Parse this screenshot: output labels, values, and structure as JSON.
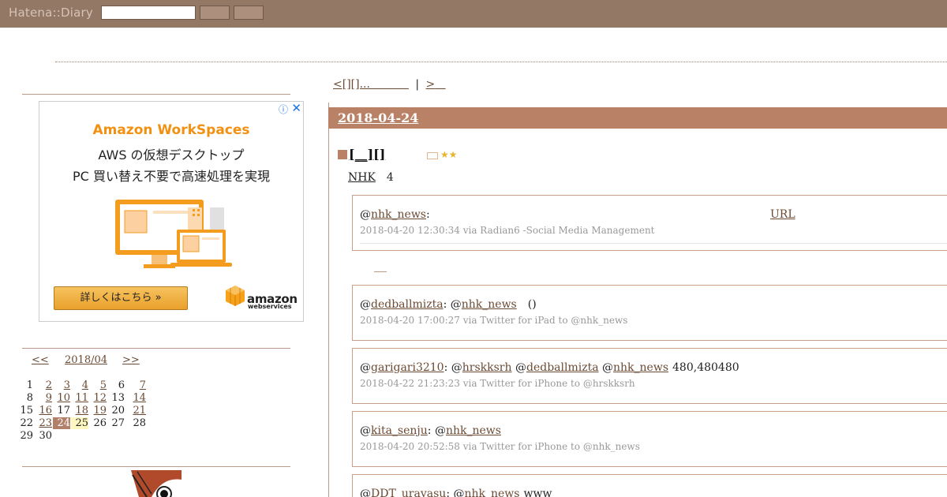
{
  "header": {
    "logo": "Hatena::Diary",
    "search": {
      "value": "",
      "placeholder": ""
    },
    "buttons": [
      "",
      ""
    ]
  },
  "ad": {
    "title": "Amazon WorkSpaces",
    "line1": "AWS の仮想デスクトップ",
    "line2": "PC 買い替え不要で高速処理を実現",
    "cta": "詳しくはこちら »",
    "brand": "amazon",
    "brand_sub": "webservices",
    "info_icon": "info-icon",
    "close_icon": "close-icon"
  },
  "calendar": {
    "prev": "<<",
    "month": "2018/04",
    "next": ">>",
    "weeks": [
      [
        {
          "d": "1",
          "link": false
        },
        {
          "d": "2",
          "link": true
        },
        {
          "d": "3",
          "link": true
        },
        {
          "d": "4",
          "link": true
        },
        {
          "d": "5",
          "link": true
        },
        {
          "d": "6",
          "link": false
        },
        {
          "d": "7",
          "link": true
        }
      ],
      [
        {
          "d": "8",
          "link": false
        },
        {
          "d": "9",
          "link": true
        },
        {
          "d": "10",
          "link": true
        },
        {
          "d": "11",
          "link": true
        },
        {
          "d": "12",
          "link": true
        },
        {
          "d": "13",
          "link": false
        },
        {
          "d": "14",
          "link": true
        }
      ],
      [
        {
          "d": "15",
          "link": false
        },
        {
          "d": "16",
          "link": true
        },
        {
          "d": "17",
          "link": false
        },
        {
          "d": "18",
          "link": true
        },
        {
          "d": "19",
          "link": true
        },
        {
          "d": "20",
          "link": false
        },
        {
          "d": "21",
          "link": true
        }
      ],
      [
        {
          "d": "22",
          "link": false
        },
        {
          "d": "23",
          "link": true
        },
        {
          "d": "24",
          "link": false,
          "today": true
        },
        {
          "d": "25",
          "link": false,
          "hl": true
        },
        {
          "d": "26",
          "link": false
        },
        {
          "d": "27",
          "link": false
        },
        {
          "d": "28",
          "link": false
        }
      ],
      [
        {
          "d": "29",
          "link": false
        },
        {
          "d": "30",
          "link": false
        }
      ]
    ]
  },
  "pager": {
    "prev": "<[][]...",
    "sep": "|",
    "next": ">"
  },
  "entry": {
    "date": "2018-04-24",
    "section_title": "[__][]",
    "stars": "★★",
    "intro_nhk": "NHK",
    "intro_count": "4"
  },
  "tweets": [
    {
      "prefix": "@",
      "user": "nhk_news",
      "after": ":",
      "extra_link": "URL",
      "meta": "2018-04-20 12:30:34 via Radian6 -Social Media Management"
    },
    {
      "prefix": "@",
      "user": "dedballmizta",
      "mid": ": @",
      "mention": "nhk_news",
      "tail": "()",
      "meta": "2018-04-20 17:00:27 via Twitter for iPad to @nhk_news"
    },
    {
      "prefix": "@",
      "user": "garigari3210",
      "mid": ": @",
      "mention": "hrskksrh",
      "mid2": " @",
      "mention2": "dedballmizta",
      "mid3": " @",
      "mention3": "nhk_news",
      "tail": "480,480480",
      "meta": "2018-04-22 21:23:23 via Twitter for iPhone to @hrskksrh"
    },
    {
      "prefix": "@",
      "user": "kita_senju",
      "mid": ": @",
      "mention": "nhk_news",
      "meta": "2018-04-20 20:52:58 via Twitter for iPhone to @nhk_news"
    },
    {
      "prefix": "@",
      "user": "DDT_urayasu",
      "mid": ": @",
      "mention": "nhk_news",
      "tail": "www"
    }
  ]
}
